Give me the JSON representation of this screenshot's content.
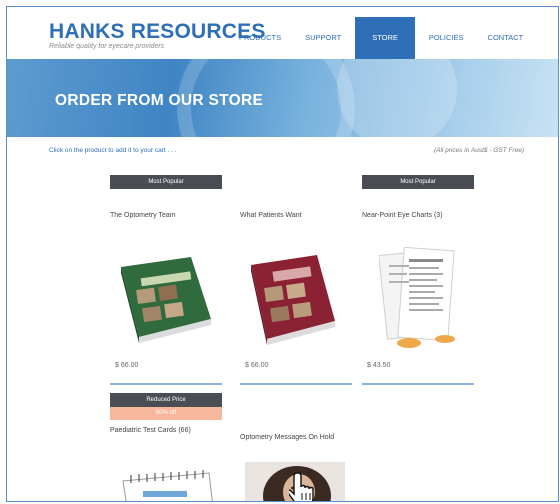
{
  "site": {
    "name": "HANKS RESOURCES",
    "tagline": "Reliable quality for eyecare providers"
  },
  "nav": {
    "items": [
      {
        "label": "PRODUCTS"
      },
      {
        "label": "SUPPORT"
      },
      {
        "label": "STORE"
      },
      {
        "label": "POLICIES"
      },
      {
        "label": "CONTACT"
      }
    ],
    "active": "STORE"
  },
  "hero": {
    "title": "ORDER FROM OUR STORE"
  },
  "store": {
    "intro": "Click on the product to add it to your cart . . .",
    "prices_note": "(All prices in Aust$ - GST Free)"
  },
  "products": [
    {
      "badge": "Most Popular",
      "title": "The Optometry Team",
      "price": "$ 66.00",
      "image_icon": "green-book-icon"
    },
    {
      "badge": "",
      "title": "What Patients Want",
      "price": "$ 66.00",
      "image_icon": "red-book-icon"
    },
    {
      "badge": "Most Popular",
      "title": "Near-Point Eye Charts (3)",
      "price": "$ 43.50",
      "image_icon": "eye-chart-cards-icon"
    },
    {
      "badge": "Reduced Price",
      "subbadge": "50% off",
      "title": "Paediatric Test Cards (66)",
      "price": "",
      "image_icon": "test-card-flipbook-icon"
    },
    {
      "badge": "",
      "title": "Optometry Messages On Hold",
      "price": "",
      "image_icon": "woman-on-phone-icon"
    }
  ],
  "colors": {
    "brand": "#2e6fb8",
    "badge_dark": "#4a4e54",
    "badge_sale": "#f6b79c",
    "underline": "#8ab4de"
  }
}
